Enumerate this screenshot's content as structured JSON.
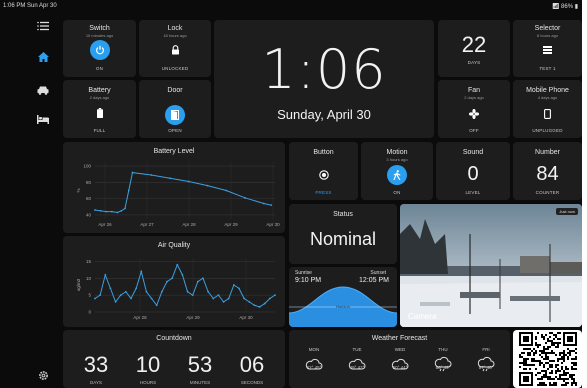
{
  "status_bar": {
    "time_date": "1:06 PM  Sun Apr 30",
    "battery": "86%"
  },
  "sidebar": {
    "icons": [
      "menu-icon",
      "home-icon",
      "car-icon",
      "bed-icon",
      "settings-icon"
    ]
  },
  "switch": {
    "title": "Switch",
    "subtitle": "10 minutes ago",
    "state": "ON"
  },
  "lock": {
    "title": "Lock",
    "subtitle": "18 hours ago",
    "state": "UNLOCKED"
  },
  "battery_tile": {
    "title": "Battery",
    "subtitle": "2 days ago",
    "state": "FULL"
  },
  "door": {
    "title": "Door",
    "state": "OPEN"
  },
  "clock": {
    "time": "1:06",
    "date": "Sunday, April 30"
  },
  "date_tile": {
    "value": "22",
    "label": "DAYS"
  },
  "selector": {
    "title": "Selector",
    "subtitle": "8 hours ago",
    "state": "TEST 1"
  },
  "fan": {
    "title": "Fan",
    "subtitle": "2 days ago",
    "state": "OFF"
  },
  "mobile": {
    "title": "Mobile Phone",
    "subtitle": "4 days ago",
    "state": "UNPLUGGED"
  },
  "button_tile": {
    "title": "Button",
    "state": "PRESS"
  },
  "motion": {
    "title": "Motion",
    "subtitle": "3 hours ago",
    "state": "ON"
  },
  "sound": {
    "title": "Sound",
    "value": "0",
    "label": "LEVEL"
  },
  "number": {
    "title": "Number",
    "value": "84",
    "label": "COUNTER"
  },
  "status_tile": {
    "title": "Status",
    "value": "Nominal"
  },
  "sun": {
    "sunrise_label": "Sunrise",
    "sunrise": "9:10 PM",
    "sunset_label": "Sunset",
    "sunset": "12:05 PM",
    "horizon": "Horizon"
  },
  "camera": {
    "label": "Camera",
    "badge": "Just now"
  },
  "countdown": {
    "title": "Countdown",
    "units": [
      {
        "value": "33",
        "label": "DAYS"
      },
      {
        "value": "10",
        "label": "HOURS"
      },
      {
        "value": "53",
        "label": "MINUTES"
      },
      {
        "value": "06",
        "label": "SECONDS"
      }
    ]
  },
  "weather": {
    "title": "Weather Forecast",
    "days": [
      {
        "day": "MON",
        "temps": "62° 45°",
        "icon": "cloud-icon"
      },
      {
        "day": "TUE",
        "temps": "49° 42°",
        "icon": "cloud-icon"
      },
      {
        "day": "WED",
        "temps": "50° 44°",
        "icon": "cloud-icon"
      },
      {
        "day": "THU",
        "temps": "56° 49°",
        "icon": "rain-cloud-icon"
      },
      {
        "day": "FRI",
        "temps": "57° 46°",
        "icon": "rain-cloud-icon"
      }
    ]
  },
  "chart_data": [
    {
      "type": "line",
      "title": "Battery Level",
      "ylabel": "%",
      "x_ticks": [
        "Apr 26",
        "Apr 27",
        "Apr 28",
        "Apr 29",
        "Apr 30"
      ],
      "y_ticks": [
        40,
        60,
        80,
        100
      ],
      "ylim": [
        35,
        105
      ],
      "xlim": [
        0,
        4.8
      ],
      "grid": true,
      "series": [
        {
          "color": "#3aa0e0",
          "x": [
            0,
            0.15,
            0.3,
            0.45,
            0.6,
            0.7,
            0.8,
            0.9,
            1.0,
            1.5,
            2.0,
            2.5,
            3.0,
            3.5,
            4.0,
            4.5,
            4.7
          ],
          "y": [
            46,
            45,
            44,
            44,
            43,
            45,
            48,
            70,
            92,
            89,
            85,
            81,
            76,
            70,
            61,
            54,
            52
          ]
        }
      ]
    },
    {
      "type": "line",
      "title": "Air Quality",
      "ylabel": "ug/m3",
      "x_ticks": [
        "Apr 28",
        "Apr 29",
        "Apr 30"
      ],
      "y_ticks": [
        0,
        5,
        10,
        15
      ],
      "ylim": [
        0,
        16
      ],
      "xlim": [
        0,
        3.5
      ],
      "grid": true,
      "series": [
        {
          "color": "#3aa0e0",
          "x": [
            0,
            0.1,
            0.2,
            0.3,
            0.4,
            0.5,
            0.6,
            0.7,
            0.8,
            0.9,
            1.0,
            1.1,
            1.2,
            1.3,
            1.4,
            1.5,
            1.6,
            1.7,
            1.8,
            1.9,
            2.0,
            2.1,
            2.2,
            2.3,
            2.4,
            2.5,
            2.6,
            2.7,
            2.8,
            2.9,
            3.0,
            3.1,
            3.2,
            3.3,
            3.4,
            3.5
          ],
          "y": [
            4,
            5,
            11,
            7,
            3,
            5,
            6,
            4,
            7,
            12,
            6,
            4,
            2,
            6,
            9,
            10,
            14,
            11,
            6,
            5,
            9,
            10,
            6,
            4,
            5,
            3,
            4,
            8,
            7,
            4,
            3,
            2,
            1.5,
            2.5,
            4,
            5
          ]
        }
      ]
    }
  ]
}
